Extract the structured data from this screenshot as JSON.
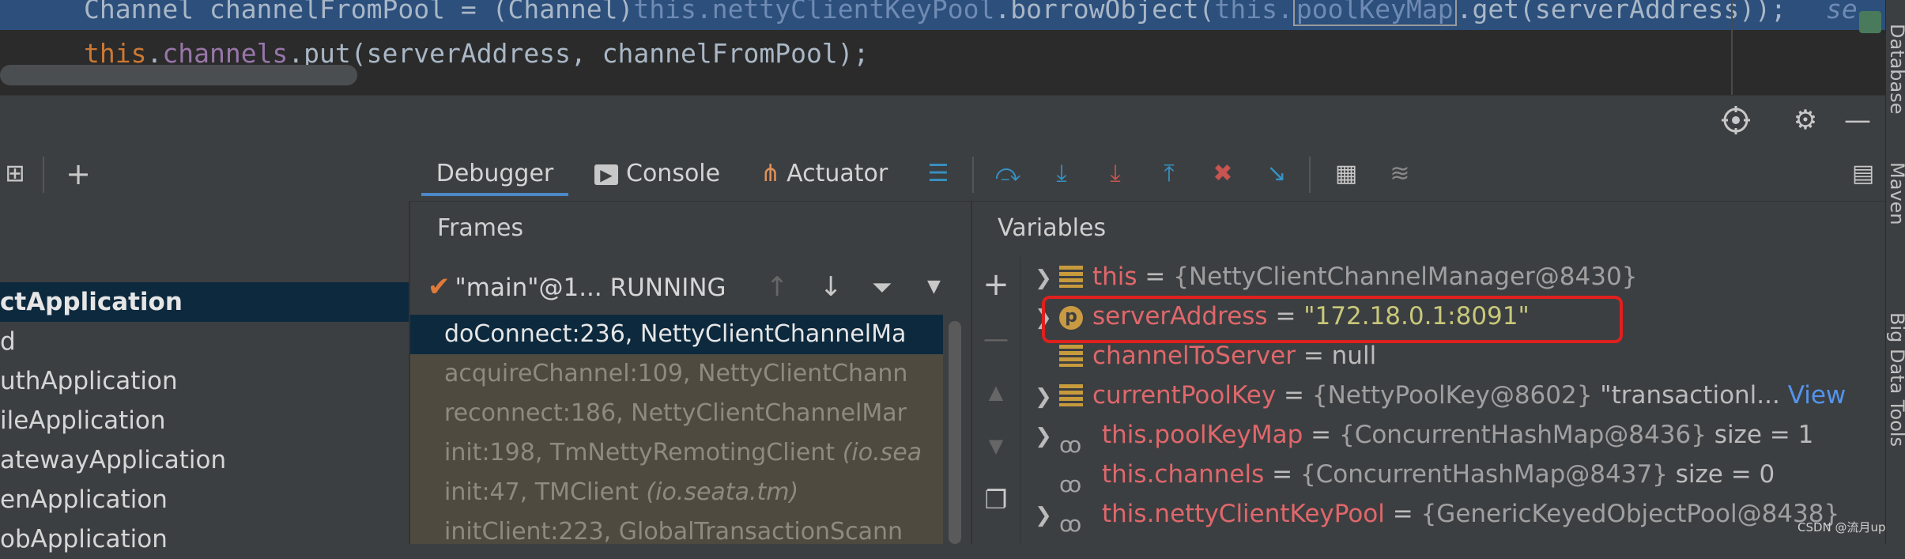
{
  "editor": {
    "line1": {
      "type": "Channel",
      "var": "channelFromPool",
      "op": " = (",
      "cast": "Channel",
      "close": ")",
      "this1": "this",
      "field1": "nettyClientKeyPool",
      "call1": ".borrowObject(",
      "this2": "this",
      "field2": "poolKeyMap",
      "call2": ".get(serverAddress));",
      "comment": "se"
    },
    "line2": {
      "this": "this",
      "field": "channels",
      "rest": ".put(serverAddress, channelFromPool);"
    }
  },
  "right_strip": {
    "labels": [
      "Database",
      "Maven",
      "Big Data Tools"
    ],
    "icons": [
      "database-icon",
      "maven-icon",
      "big-data-tools-icon"
    ]
  },
  "header": {
    "icons": [
      "crosshair-icon",
      "gear-icon",
      "minimize-icon"
    ]
  },
  "toolbar": {
    "left_icons": [
      "restore-layout-icon",
      "add-icon"
    ],
    "tabs": [
      {
        "label": "Debugger",
        "icon": "debugger-tab",
        "active": true
      },
      {
        "label": "Console",
        "icon": "console-icon"
      },
      {
        "label": "Actuator",
        "icon": "actuator-icon"
      }
    ],
    "actions": [
      "menu-icon",
      "show-execution-point-icon",
      "step-over-icon",
      "step-into-icon",
      "force-step-into-icon",
      "step-out-icon",
      "drop-frame-icon",
      "run-to-cursor-icon",
      "evaluate-expression-icon",
      "trace-current-stream-icon",
      "layout-icon"
    ]
  },
  "left_panel": {
    "items": [
      {
        "label": "",
        "selected": false
      },
      {
        "label": "ctApplication",
        "selected": true
      },
      {
        "label": "d",
        "selected": false
      },
      {
        "label": "uthApplication",
        "selected": false
      },
      {
        "label": "ileApplication",
        "selected": false
      },
      {
        "label": "atewayApplication",
        "selected": false
      },
      {
        "label": "enApplication",
        "selected": false
      },
      {
        "label": "obApplication",
        "selected": false
      }
    ]
  },
  "frames": {
    "title": "Frames",
    "thread": "\"main\"@1... RUNNING",
    "items": [
      {
        "text": "doConnect:236, NettyClientChannelMa",
        "pkg": "",
        "selected": true
      },
      {
        "text": "acquireChannel:109, NettyClientChann",
        "pkg": ""
      },
      {
        "text": "reconnect:186, NettyClientChannelMar",
        "pkg": ""
      },
      {
        "text": "init:198, TmNettyRemotingClient ",
        "pkg": "(io.sea"
      },
      {
        "text": "init:47, TMClient ",
        "pkg": "(io.seata.tm)"
      },
      {
        "text": "initClient:223, GlobalTransactionScann",
        "pkg": ""
      }
    ]
  },
  "variables": {
    "title": "Variables",
    "rows": [
      {
        "expand": true,
        "icon": "field",
        "name": "this",
        "eq": " = ",
        "value": "{NettyClientChannelManager@8430}",
        "extra": "",
        "link": ""
      },
      {
        "expand": true,
        "icon": "p",
        "name": "serverAddress",
        "eq": " = ",
        "value": "\"172.18.0.1:8091\"",
        "extra": "",
        "link": "",
        "string": true
      },
      {
        "expand": false,
        "icon": "field",
        "name": "channelToServer",
        "eq": " = ",
        "value": "null",
        "extra": "",
        "link": ""
      },
      {
        "expand": true,
        "icon": "field",
        "name": "currentPoolKey",
        "eq": " = ",
        "value": "{NettyPoolKey@8602}",
        "extra": " \"transactionl...",
        "link": " View"
      },
      {
        "expand": true,
        "icon": "oo",
        "name": "this.poolKeyMap",
        "eq": " = ",
        "value": "{ConcurrentHashMap@8436}",
        "extra": "  size = 1",
        "link": ""
      },
      {
        "expand": false,
        "icon": "oo",
        "name": "this.channels",
        "eq": " = ",
        "value": "{ConcurrentHashMap@8437}",
        "extra": "  size = 0",
        "link": ""
      },
      {
        "expand": true,
        "icon": "oo",
        "name": "this.nettyClientKeyPool",
        "eq": " = ",
        "value": "{GenericKeyedObjectPool@8438}",
        "extra": "",
        "link": ""
      }
    ],
    "side_icons": [
      "add-watch-icon",
      "remove-watch-icon",
      "move-up-icon",
      "move-down-icon",
      "copy-icon"
    ]
  },
  "watermark": "CSDN @流月up"
}
